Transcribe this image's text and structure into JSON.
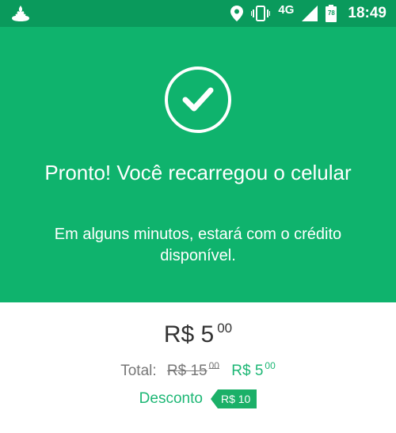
{
  "status_bar": {
    "network": "4G",
    "battery": "78",
    "time": "18:49",
    "icons": [
      "santander-logo-icon",
      "location-icon",
      "vibrate-icon",
      "signal-icon",
      "battery-icon"
    ]
  },
  "hero": {
    "title": "Pronto! Você recarregou o celular",
    "subtitle": "Em alguns minutos, estará com o crédito disponível.",
    "icon": "check-circle-icon"
  },
  "summary": {
    "amount_main": "R$ 5",
    "amount_cents": "00",
    "total_label": "Total:",
    "old_total_main": "R$ 15",
    "old_total_cents": "00",
    "new_total_main": "R$ 5",
    "new_total_cents": "00",
    "discount_label": "Desconto",
    "discount_value": "R$ 10"
  },
  "colors": {
    "hero_bg": "#0fb36d",
    "status_bg": "#0a9a5c",
    "accent": "#1db775"
  }
}
